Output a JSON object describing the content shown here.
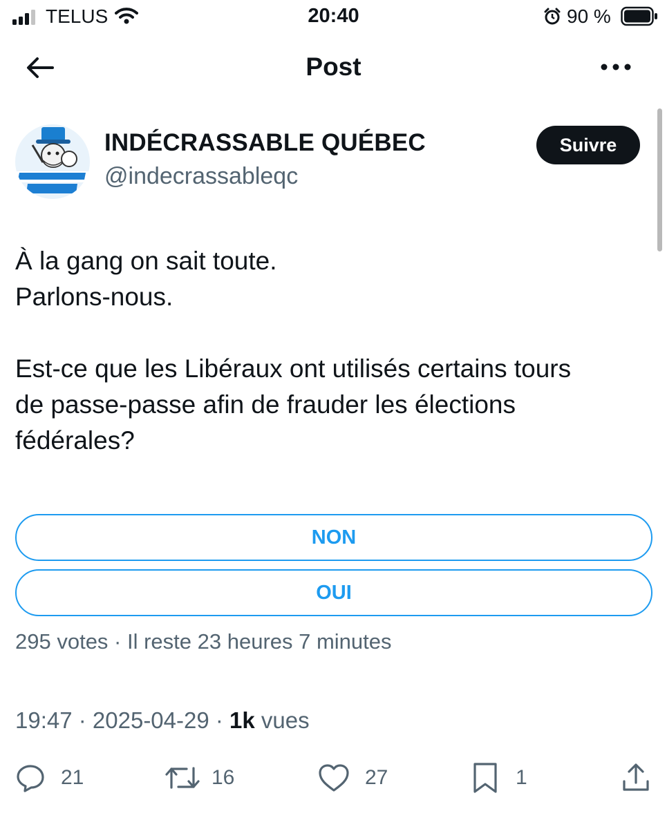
{
  "status_bar": {
    "carrier": "TELUS",
    "time": "20:40",
    "battery": "90 %"
  },
  "header": {
    "title": "Post",
    "back_icon": "arrow-left-icon",
    "more_icon": "more-horizontal-icon"
  },
  "author": {
    "display_name": "INDÉCRASSABLE QUÉBEC",
    "handle": "@indecrassableqc",
    "follow_label": "Suivre"
  },
  "post": {
    "text": "À la gang on sait toute.\nParlons-nous.\n\nEst-ce que les Libéraux ont utilisés certains tours\nde passe-passe afin de frauder les élections\nfédérales?"
  },
  "poll": {
    "options": [
      {
        "label": "NON"
      },
      {
        "label": "OUI"
      }
    ],
    "meta": "295 votes · Il reste 23 heures 7 minutes"
  },
  "timestamp": {
    "time_date": "19:47 · 2025-04-29 · ",
    "views_count": "1k",
    "views_label": " vues"
  },
  "actions": {
    "replies": "21",
    "reposts": "16",
    "likes": "27",
    "bookmarks": "1"
  },
  "colors": {
    "accent": "#1d9bf0",
    "text": "#0f1419",
    "secondary": "#536471"
  }
}
